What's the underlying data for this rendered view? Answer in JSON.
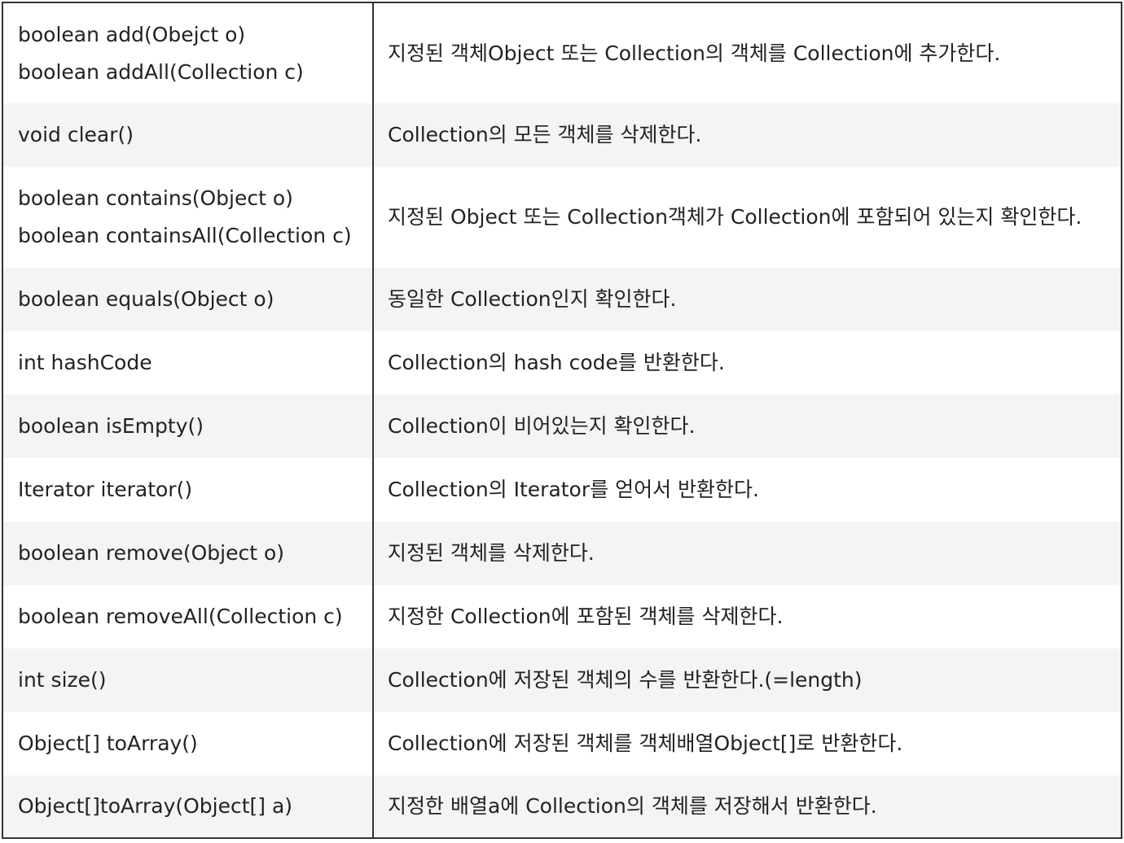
{
  "table": {
    "rows": [
      {
        "method": [
          "boolean add(Obejct o)",
          "boolean addAll(Collection c)"
        ],
        "description": "지정된 객체Object 또는 Collection의 객체를 Collection에 추가한다."
      },
      {
        "method": [
          "void clear()"
        ],
        "description": "Collection의 모든 객체를 삭제한다."
      },
      {
        "method": [
          "boolean contains(Object o)",
          "boolean containsAll(Collection c)"
        ],
        "description": "지정된 Object 또는 Collection객체가 Collection에 포함되어 있는지 확인한다."
      },
      {
        "method": [
          "boolean equals(Object o)"
        ],
        "description": "동일한 Collection인지 확인한다."
      },
      {
        "method": [
          "int hashCode"
        ],
        "description": "Collection의 hash code를 반환한다."
      },
      {
        "method": [
          "boolean isEmpty()"
        ],
        "description": "Collection이 비어있는지 확인한다."
      },
      {
        "method": [
          "Iterator iterator()"
        ],
        "description": "Collection의 Iterator를 얻어서 반환한다."
      },
      {
        "method": [
          "boolean remove(Object o)"
        ],
        "description": "지정된 객체를 삭제한다."
      },
      {
        "method": [
          "boolean removeAll(Collection c)"
        ],
        "description": "지정한 Collection에 포함된 객체를 삭제한다."
      },
      {
        "method": [
          "int size()"
        ],
        "description": "Collection에 저장된 객체의 수를 반환한다.(=length)"
      },
      {
        "method": [
          "Object[] toArray()"
        ],
        "description": "Collection에 저장된 객체를 객체배열Object[]로 반환한다."
      },
      {
        "method": [
          "Object[]toArray(Object[] a)"
        ],
        "description": "지정한 배열a에 Collection의 객체를 저장해서 반환한다."
      }
    ]
  },
  "colors": {
    "row_alt_background": "#f3f4f5",
    "row_background": "#ffffff",
    "border": "#333333",
    "text": "#222222"
  }
}
